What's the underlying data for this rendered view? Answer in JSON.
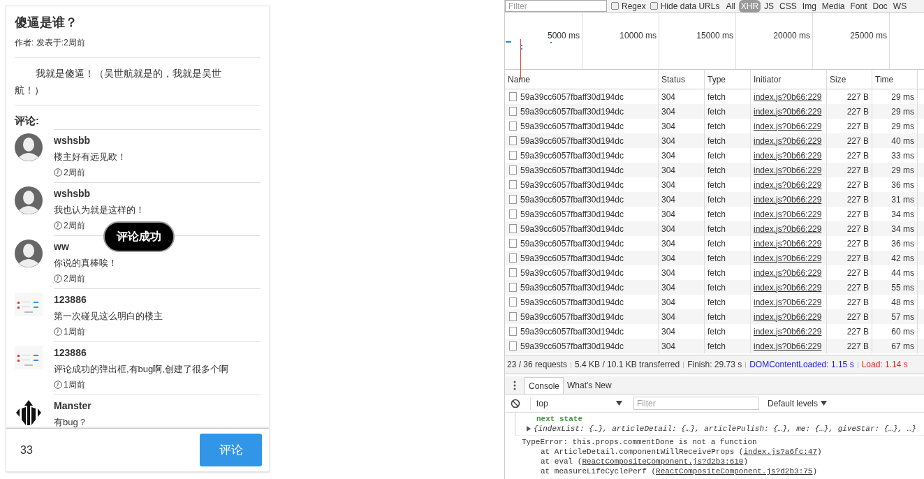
{
  "article": {
    "title": "傻逼是谁？",
    "meta": "作者:  发表于:2周前",
    "body": "我就是傻逼！（吴世航就是的，我就是吴世航！）",
    "comments_heading": "评论:",
    "comments": [
      {
        "kind": "person",
        "user": "wshsbb",
        "text": "楼主好有远见欧！",
        "time": "2周前"
      },
      {
        "kind": "person",
        "user": "wshsbb",
        "text": "我也认为就是这样的！",
        "time": "2周前"
      },
      {
        "kind": "person",
        "user": "ww",
        "text": "你说的真棒唉！",
        "time": "2周前"
      },
      {
        "kind": "screenshot",
        "user": "123886",
        "text": "第一次碰见这么明白的楼主",
        "time": "1周前"
      },
      {
        "kind": "screenshot",
        "user": "123886",
        "text": "评论成功的弹出框,有bug啊,创建了很多个啊",
        "time": "1周前"
      },
      {
        "kind": "logo",
        "user": "Manster",
        "text": "有bug？"
      }
    ],
    "comment_input": {
      "value": "33"
    },
    "submit_button": "评论",
    "toast": "评论成功"
  },
  "devtools": {
    "filter": {
      "placeholder": "Filter"
    },
    "options": [
      {
        "label": "Regex",
        "checked": false
      },
      {
        "label": "Hide data URLs",
        "checked": false
      }
    ],
    "type_filters": [
      {
        "label": "All",
        "selected": false
      },
      {
        "label": "XHR",
        "selected": true
      },
      {
        "label": "JS",
        "selected": false
      },
      {
        "label": "CSS",
        "selected": false
      },
      {
        "label": "Img",
        "selected": false
      },
      {
        "label": "Media",
        "selected": false
      },
      {
        "label": "Font",
        "selected": false
      },
      {
        "label": "Doc",
        "selected": false
      },
      {
        "label": "WS",
        "selected": false
      }
    ],
    "timeline_ticks": [
      "5000 ms",
      "10000 ms",
      "15000 ms",
      "20000 ms",
      "25000 ms"
    ],
    "table": {
      "columns": [
        "Name",
        "Status",
        "Type",
        "Initiator",
        "Size",
        "Time"
      ],
      "rows": [
        [
          "59a39cc6057fbaff30d194dc",
          "304",
          "fetch",
          "index.js?0b66:229",
          "227 B",
          "29 ms"
        ],
        [
          "59a39cc6057fbaff30d194dc",
          "304",
          "fetch",
          "index.js?0b66:229",
          "227 B",
          "29 ms"
        ],
        [
          "59a39cc6057fbaff30d194dc",
          "304",
          "fetch",
          "index.js?0b66:229",
          "227 B",
          "29 ms"
        ],
        [
          "59a39cc6057fbaff30d194dc",
          "304",
          "fetch",
          "index.js?0b66:229",
          "227 B",
          "40 ms"
        ],
        [
          "59a39cc6057fbaff30d194dc",
          "304",
          "fetch",
          "index.js?0b66:229",
          "227 B",
          "33 ms"
        ],
        [
          "59a39cc6057fbaff30d194dc",
          "304",
          "fetch",
          "index.js?0b66:229",
          "227 B",
          "29 ms"
        ],
        [
          "59a39cc6057fbaff30d194dc",
          "304",
          "fetch",
          "index.js?0b66:229",
          "227 B",
          "36 ms"
        ],
        [
          "59a39cc6057fbaff30d194dc",
          "304",
          "fetch",
          "index.js?0b66:229",
          "227 B",
          "31 ms"
        ],
        [
          "59a39cc6057fbaff30d194dc",
          "304",
          "fetch",
          "index.js?0b66:229",
          "227 B",
          "34 ms"
        ],
        [
          "59a39cc6057fbaff30d194dc",
          "304",
          "fetch",
          "index.js?0b66:229",
          "227 B",
          "34 ms"
        ],
        [
          "59a39cc6057fbaff30d194dc",
          "304",
          "fetch",
          "index.js?0b66:229",
          "227 B",
          "36 ms"
        ],
        [
          "59a39cc6057fbaff30d194dc",
          "304",
          "fetch",
          "index.js?0b66:229",
          "227 B",
          "42 ms"
        ],
        [
          "59a39cc6057fbaff30d194dc",
          "304",
          "fetch",
          "index.js?0b66:229",
          "227 B",
          "44 ms"
        ],
        [
          "59a39cc6057fbaff30d194dc",
          "304",
          "fetch",
          "index.js?0b66:229",
          "227 B",
          "55 ms"
        ],
        [
          "59a39cc6057fbaff30d194dc",
          "304",
          "fetch",
          "index.js?0b66:229",
          "227 B",
          "48 ms"
        ],
        [
          "59a39cc6057fbaff30d194dc",
          "304",
          "fetch",
          "index.js?0b66:229",
          "227 B",
          "57 ms"
        ],
        [
          "59a39cc6057fbaff30d194dc",
          "304",
          "fetch",
          "index.js?0b66:229",
          "227 B",
          "60 ms"
        ],
        [
          "59a39cc6057fbaff30d194dc",
          "304",
          "fetch",
          "index.js?0b66:229",
          "227 B",
          "67 ms"
        ]
      ]
    },
    "summary": [
      {
        "kind": "plain",
        "text": "23 / 36 requests"
      },
      {
        "kind": "plain",
        "text": "5.4 KB / 10.1 KB transferred"
      },
      {
        "kind": "plain",
        "text": "Finish: 29.73 s"
      },
      {
        "kind": "dom",
        "text": "DOMContentLoaded: 1.15 s"
      },
      {
        "kind": "load",
        "text": "Load: 1.14 s"
      }
    ],
    "drawer_tabs": [
      {
        "label": "Console",
        "selected": true
      },
      {
        "label": "What's New",
        "selected": false
      }
    ],
    "console_toolbar": {
      "context": "top",
      "filter": {
        "placeholder": "Filter"
      },
      "levels": "Default levels"
    },
    "log": {
      "label": "next state",
      "object": "{indexList: {…}, articleDetail: {…}, articlePulish: {…}, me: {…}, giveStar: {…}, …}"
    },
    "error": {
      "message": "TypeError: this.props.commentDone is not a function",
      "stack": [
        {
          "prefix": "at ArticleDetail.componentWillReceiveProps (",
          "link": "index.js?a6fc:47",
          "suffix": ")"
        },
        {
          "prefix": "at eval (",
          "link": "ReactCompositeComponent.js?d2b3:610",
          "suffix": ")"
        },
        {
          "prefix": "at measureLifeCyclePerf (",
          "link": "ReactCompositeComponent.js?d2b3:75",
          "suffix": ")"
        }
      ]
    }
  }
}
